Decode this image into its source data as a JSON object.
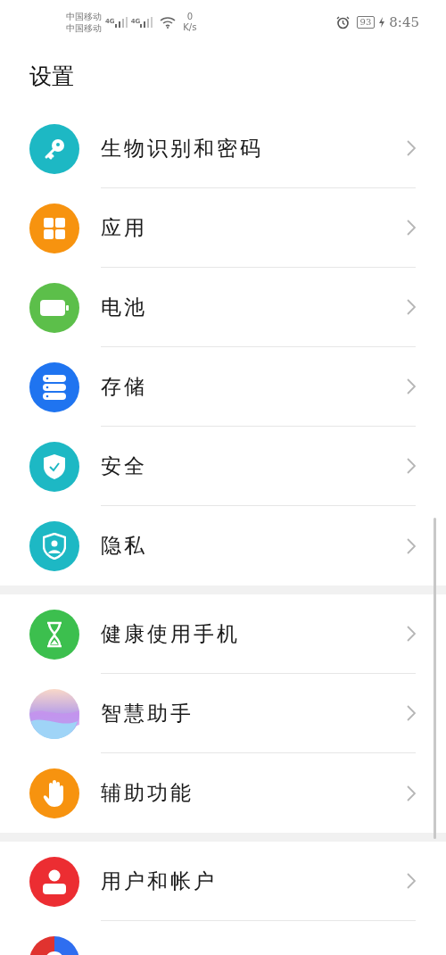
{
  "status_bar": {
    "carriers": [
      "中国移动",
      "中国移动"
    ],
    "networks": [
      "4G",
      "4G"
    ],
    "speed_value": "0",
    "speed_unit": "K/s",
    "battery": "93",
    "time": "8:45"
  },
  "title": "设置",
  "groups": [
    {
      "items": [
        {
          "label": "生物识别和密码",
          "color": "#1db8c4"
        },
        {
          "label": "应用",
          "color": "#f7930f"
        },
        {
          "label": "电池",
          "color": "#5cbf4a"
        },
        {
          "label": "存储",
          "color": "#1f74f0"
        },
        {
          "label": "安全",
          "color": "#1db8c4"
        },
        {
          "label": "隐私",
          "color": "#1db8c4"
        }
      ]
    },
    {
      "items": [
        {
          "label": "健康使用手机",
          "color": "#3cbf4e"
        },
        {
          "label": "智慧助手",
          "color": "#b8a0e8"
        },
        {
          "label": "辅助功能",
          "color": "#f7930f"
        }
      ]
    },
    {
      "items": [
        {
          "label": "用户和帐户",
          "color": "#ec2d32"
        },
        {
          "color": "#2f6ef0"
        }
      ]
    }
  ]
}
